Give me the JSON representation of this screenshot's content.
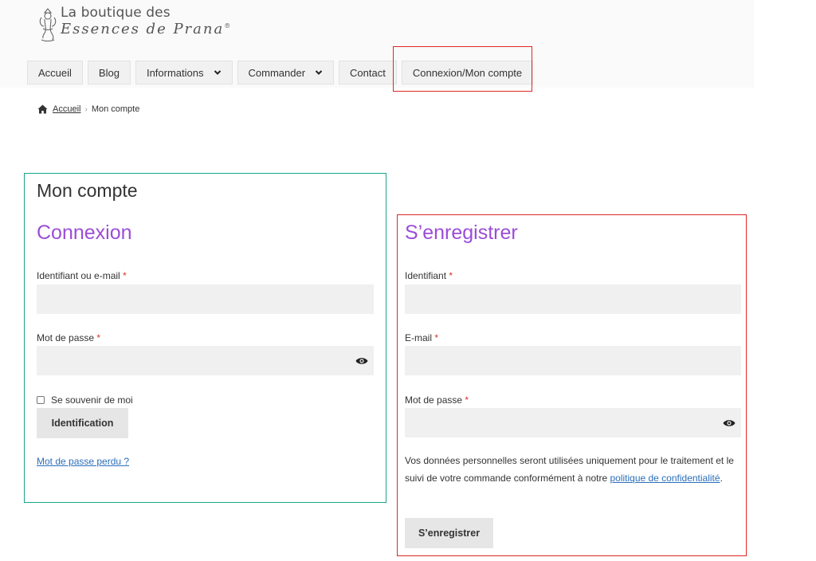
{
  "logo": {
    "line1": "La boutique des",
    "line2": "Essences de Prana",
    "trademark": "®",
    "icon": "ganesha-logo-icon"
  },
  "nav": {
    "items": [
      {
        "label": "Accueil",
        "dropdown": false
      },
      {
        "label": "Blog",
        "dropdown": false
      },
      {
        "label": "Informations",
        "dropdown": true
      },
      {
        "label": "Commander",
        "dropdown": true
      },
      {
        "label": "Contact",
        "dropdown": false
      },
      {
        "label": "Connexion/Mon compte",
        "dropdown": false
      }
    ]
  },
  "breadcrumb": {
    "icon": "home-icon",
    "home": "Accueil",
    "separator": "›",
    "current": "Mon compte"
  },
  "page": {
    "title": "Mon compte"
  },
  "login": {
    "title": "Connexion",
    "username_label": "Identifiant ou e-mail",
    "password_label": "Mot de passe",
    "required_mark": "*",
    "remember_label": "Se souvenir de moi",
    "submit_label": "Identification",
    "lost_password": "Mot de passe perdu ?"
  },
  "register": {
    "title": "S’enregistrer",
    "username_label": "Identifiant",
    "email_label": "E-mail",
    "password_label": "Mot de passe",
    "required_mark": "*",
    "privacy_text": "Vos données personnelles seront utilisées uniquement pour le traitement et le suivi de votre commande conformément à notre ",
    "privacy_link": "politique de confidentialité",
    "privacy_end": ".",
    "submit_label": "S’enregistrer"
  },
  "colors": {
    "accent_title": "#9b4dd8",
    "link": "#2c6fbb",
    "required": "#d9342b",
    "highlight_red": "#e02626",
    "highlight_green": "#1aa58a"
  }
}
